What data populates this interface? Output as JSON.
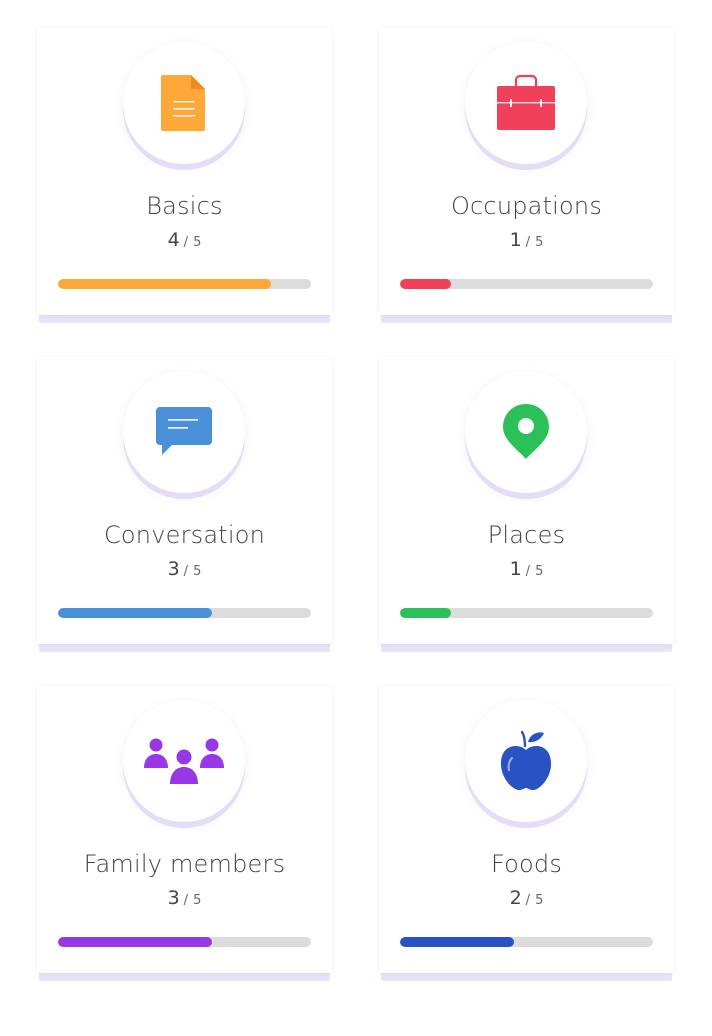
{
  "cards": [
    {
      "title": "Basics",
      "score": "4",
      "separator": "/",
      "total": "5",
      "progress": 0.84,
      "color": "#FFA83A",
      "icon": "document-icon"
    },
    {
      "title": "Occupations",
      "score": "1",
      "separator": "/",
      "total": "5",
      "progress": 0.2,
      "color": "#F0405A",
      "icon": "briefcase-icon"
    },
    {
      "title": "Conversation",
      "score": "3",
      "separator": "/",
      "total": "5",
      "progress": 0.61,
      "color": "#4A90D9",
      "icon": "chat-bubble-icon"
    },
    {
      "title": "Places",
      "score": "1",
      "separator": "/",
      "total": "5",
      "progress": 0.2,
      "color": "#2CC05A",
      "icon": "location-pin-icon"
    },
    {
      "title": "Family members",
      "score": "3",
      "separator": "/",
      "total": "5",
      "progress": 0.61,
      "color": "#9737E6",
      "icon": "people-icon"
    },
    {
      "title": "Foods",
      "score": "2",
      "separator": "/",
      "total": "5",
      "progress": 0.45,
      "color": "#2952C2",
      "icon": "apple-icon"
    }
  ]
}
